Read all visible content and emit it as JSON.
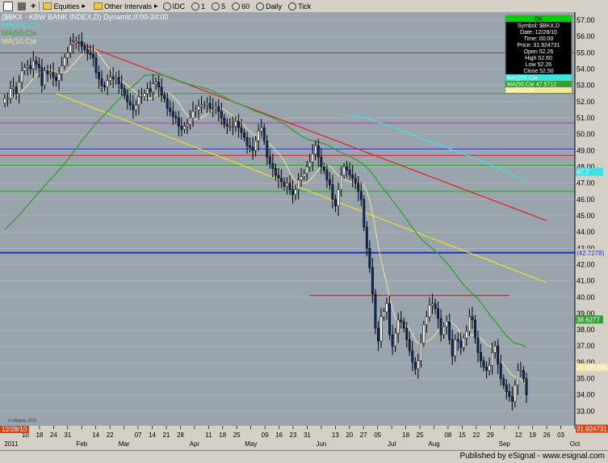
{
  "toolbar": {
    "items": [
      "Equities",
      "Other Intervals",
      "IDC",
      "1",
      "5",
      "60",
      "Daily",
      "Tick"
    ]
  },
  "footer": {
    "published": "Published by eSignal - www.esignal.com"
  },
  "chart_data": {
    "type": "candlestick",
    "title": "($BKX - KBW BANK INDEX,D) Dynamic,0:00-24:00",
    "legend": [
      {
        "label": "MA(200,C)e",
        "color": "#40e0e0"
      },
      {
        "label": "MA(50,C)e",
        "color": "#30a030"
      },
      {
        "label": "MA(10,C)e",
        "color": "#f0e6a0"
      }
    ],
    "y_ticks": [
      33.0,
      34.0,
      35.0,
      36.0,
      37.0,
      38.0,
      39.0,
      40.0,
      41.0,
      42.0,
      43.0,
      44.0,
      45.0,
      46.0,
      47.0,
      48.0,
      49.0,
      50.0,
      51.0,
      52.0,
      53.0,
      54.0,
      55.0,
      56.0,
      57.0
    ],
    "ylim": [
      32.1,
      57.5
    ],
    "x_tick_labels": [
      "2011",
      "10",
      "18",
      "24",
      "31",
      "Feb",
      "14",
      "22",
      "Mar",
      "07",
      "14",
      "21",
      "28",
      "Apr",
      "11",
      "18",
      "25",
      "May",
      "09",
      "16",
      "23",
      "31",
      "Jun",
      "13",
      "20",
      "27",
      "05",
      "Jul",
      "18",
      "25",
      "Aug",
      "08",
      "15",
      "22",
      "29",
      "Sep",
      "12",
      "19",
      "26",
      "03",
      "Oct"
    ],
    "month_labels": [
      "2011",
      "Feb",
      "Mar",
      "Apr",
      "May",
      "Jun",
      "Jul",
      "Aug",
      "Sep",
      "Oct"
    ],
    "horizontal_lines": [
      {
        "value": 55.0,
        "color": "#b03030"
      },
      {
        "value": 52.5,
        "color": "#30a030"
      },
      {
        "value": 50.7,
        "color": "#a040a0"
      },
      {
        "value": 49.1,
        "color": "#3030c0"
      },
      {
        "value": 48.7,
        "color": "#c03030"
      },
      {
        "value": 48.1,
        "color": "#30a030"
      },
      {
        "value": 46.5,
        "color": "#30a030"
      },
      {
        "value": 42.7278,
        "color": "#2030c0"
      }
    ],
    "price_boxes": [
      {
        "value": 47.7,
        "text": "47.7",
        "bg": "#40e0e0",
        "fg": "#ffffff"
      },
      {
        "value": 42.7278,
        "text": "(42.7278)",
        "bg": "#d4d0c8",
        "fg": "#2030c0"
      },
      {
        "value": 38.6277,
        "text": "38.6277",
        "bg": "#30a030",
        "fg": "#ffffff"
      },
      {
        "value": 35.685385,
        "text": "35.685385",
        "bg": "#f0e6a0",
        "fg": "#ffffff"
      },
      {
        "value": 31.924731,
        "text": "31.924731",
        "bg": "#e04010",
        "fg": "#ffffff"
      }
    ],
    "date_box": "12/28/10",
    "copyright": "© eSignal, 2011",
    "info_box": {
      "header": "OK",
      "rows": [
        "Symbol: $BKX,D",
        "Date: 12/28/10",
        "Time: 00:00",
        "Price: 31.924731",
        "Open 52.26",
        "High 52.60",
        "Low 52.26",
        "Close 52.50"
      ],
      "ma200": "MA(200,C)e",
      "ma50": "MA(50,C)e 47.5712",
      "ma10": "MA(10,C)e"
    },
    "trendlines": [
      {
        "color": "#e02020",
        "x": [
          23,
          139
        ],
        "y": [
          55.8,
          44.7
        ]
      },
      {
        "color": "#e8e030",
        "x": [
          18,
          139
        ],
        "y": [
          52.5,
          40.9
        ]
      },
      {
        "color": "#d02020",
        "x": [
          107,
          126
        ],
        "y": [
          40.1,
          40.1
        ]
      }
    ],
    "close": [
      52.2,
      52.2,
      52.8,
      52.9,
      52.5,
      53.2,
      53.9,
      54.1,
      54.2,
      54.0,
      54.5,
      54.3,
      54.1,
      53.0,
      53.9,
      53.7,
      53.8,
      53.5,
      53.3,
      53.7,
      54.2,
      54.7,
      55.0,
      55.5,
      55.6,
      55.7,
      55.7,
      55.4,
      55.2,
      55.0,
      54.9,
      54.7,
      53.8,
      53.4,
      53.0,
      52.9,
      53.3,
      53.5,
      53.4,
      53.5,
      53.1,
      52.8,
      52.4,
      52.0,
      51.8,
      51.5,
      51.8,
      52.3,
      52.3,
      52.5,
      52.8,
      52.6,
      53.1,
      53.2,
      52.9,
      52.4,
      52.2,
      51.6,
      51.4,
      51.1,
      51.0,
      50.5,
      50.3,
      50.5,
      50.6,
      51.0,
      51.4,
      51.5,
      51.7,
      51.8,
      51.8,
      51.9,
      51.6,
      51.6,
      51.7,
      51.4,
      51.0,
      50.6,
      50.5,
      50.5,
      50.5,
      50.8,
      50.4,
      50.1,
      49.8,
      49.3,
      49.2,
      49.0,
      49.6,
      50.2,
      50.4,
      49.6,
      48.6,
      48.2,
      47.9,
      47.5,
      47.3,
      47.1,
      46.8,
      47.0,
      46.6,
      46.3,
      46.6,
      47.2,
      47.4,
      47.6,
      48.0,
      48.3,
      48.8,
      49.3,
      48.6,
      48.0,
      47.8,
      47.2,
      46.9,
      46.0,
      45.6,
      46.6,
      47.5,
      48.0,
      47.8,
      47.5,
      47.3,
      47.0,
      46.5,
      46.0,
      44.3,
      43.0,
      41.8,
      40.2,
      38.1,
      37.3,
      38.8,
      39.1,
      39.6,
      37.7,
      37.0,
      37.8,
      38.6,
      38.5,
      38.1,
      37.4,
      36.7,
      36.0,
      35.6,
      36.1,
      37.2,
      38.3,
      38.8,
      39.5,
      39.6,
      39.3,
      38.7,
      37.7,
      38.2,
      38.5,
      37.4,
      36.4,
      37.4,
      37.3,
      36.9,
      37.5,
      37.9,
      38.8,
      38.6,
      37.5,
      36.6,
      36.1,
      35.7,
      35.5,
      35.8,
      36.6,
      37.0,
      35.9,
      35.0,
      34.6,
      34.2,
      33.9,
      33.6,
      34.6,
      35.5,
      35.5,
      35.0,
      34.0
    ]
  }
}
